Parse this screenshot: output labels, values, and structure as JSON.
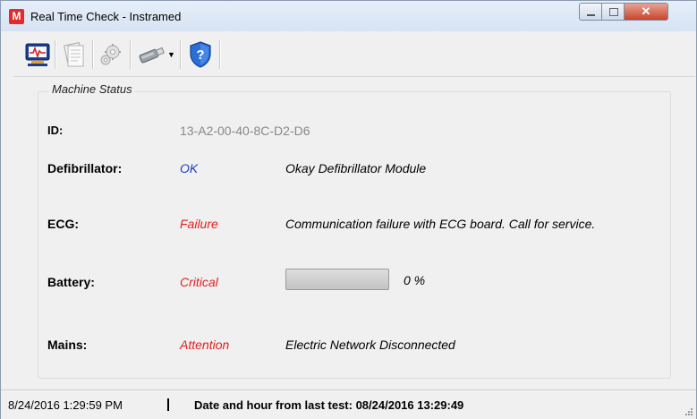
{
  "window": {
    "title": "Real Time Check - Instramed",
    "app_icon_letter": "M",
    "close_glyph": "✕"
  },
  "toolbar": {
    "buttons": [
      {
        "name": "monitor-icon",
        "enabled": true
      },
      {
        "name": "report-document-icon",
        "enabled": false
      },
      {
        "name": "settings-gear-icon",
        "enabled": false
      },
      {
        "name": "usb-connection-icon",
        "enabled": true,
        "dropdown": true
      },
      {
        "name": "help-shield-icon",
        "enabled": true
      }
    ]
  },
  "machine_status": {
    "group_title": "Machine Status",
    "id": {
      "label": "ID:",
      "value": "13-A2-00-40-8C-D2-D6"
    },
    "defibrillator": {
      "label": "Defibrillator:",
      "status": "OK",
      "description": "Okay Defibrillator Module"
    },
    "ecg": {
      "label": "ECG:",
      "status": "Failure",
      "description": "Communication failure with ECG board. Call for service."
    },
    "battery": {
      "label": "Battery:",
      "status": "Critical",
      "level_percent": 0,
      "level_text": "0 %"
    },
    "mains": {
      "label": "Mains:",
      "status": "Attention",
      "description": "Electric Network Disconnected"
    }
  },
  "statusbar": {
    "current_time": "8/24/2016 1:29:59 PM",
    "last_test": "Date and hour from last test:  08/24/2016 13:29:49"
  },
  "colors": {
    "ok": "#1f3fbf",
    "error": "#e02020",
    "id_value": "#888888"
  }
}
